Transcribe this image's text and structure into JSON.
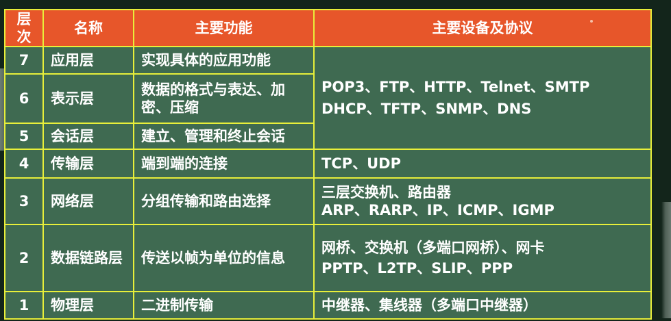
{
  "headers": {
    "level": "层次",
    "name": "名称",
    "function": "主要功能",
    "devices": "主要设备及协议"
  },
  "rows": [
    {
      "level": "7",
      "name": "应用层",
      "function": "实现具体的应用功能"
    },
    {
      "level": "6",
      "name": "表示层",
      "function": "数据的格式与表达、加密、压缩"
    },
    {
      "level": "5",
      "name": "会话层",
      "function": "建立、管理和终止会话"
    },
    {
      "level": "4",
      "name": "传输层",
      "function": "端到端的连接",
      "devices": [
        "TCP、UDP"
      ]
    },
    {
      "level": "3",
      "name": "网络层",
      "function": "分组传输和路由选择",
      "devices": [
        "三层交换机、路由器",
        "ARP、RARP、IP、ICMP、IGMP"
      ]
    },
    {
      "level": "2",
      "name": "数据链路层",
      "function": "传送以帧为单位的信息",
      "devices": [
        "网桥、交换机（多端口网桥）、网卡",
        "PPTP、L2TP、SLIP、PPP"
      ]
    },
    {
      "level": "1",
      "name": "物理层",
      "function": "二进制传输",
      "devices": [
        "中继器、集线器（多端口中继器）"
      ]
    }
  ],
  "upper_layers_devices": [
    "POP3、FTP、HTTP、Telnet、SMTP",
    "DHCP、TFTP、SNMP、DNS"
  ],
  "colors": {
    "header_bg": "#e7562a",
    "body_bg": "#3f6a51",
    "grid_line": "#e8ef3a",
    "text": "#ffffff"
  }
}
